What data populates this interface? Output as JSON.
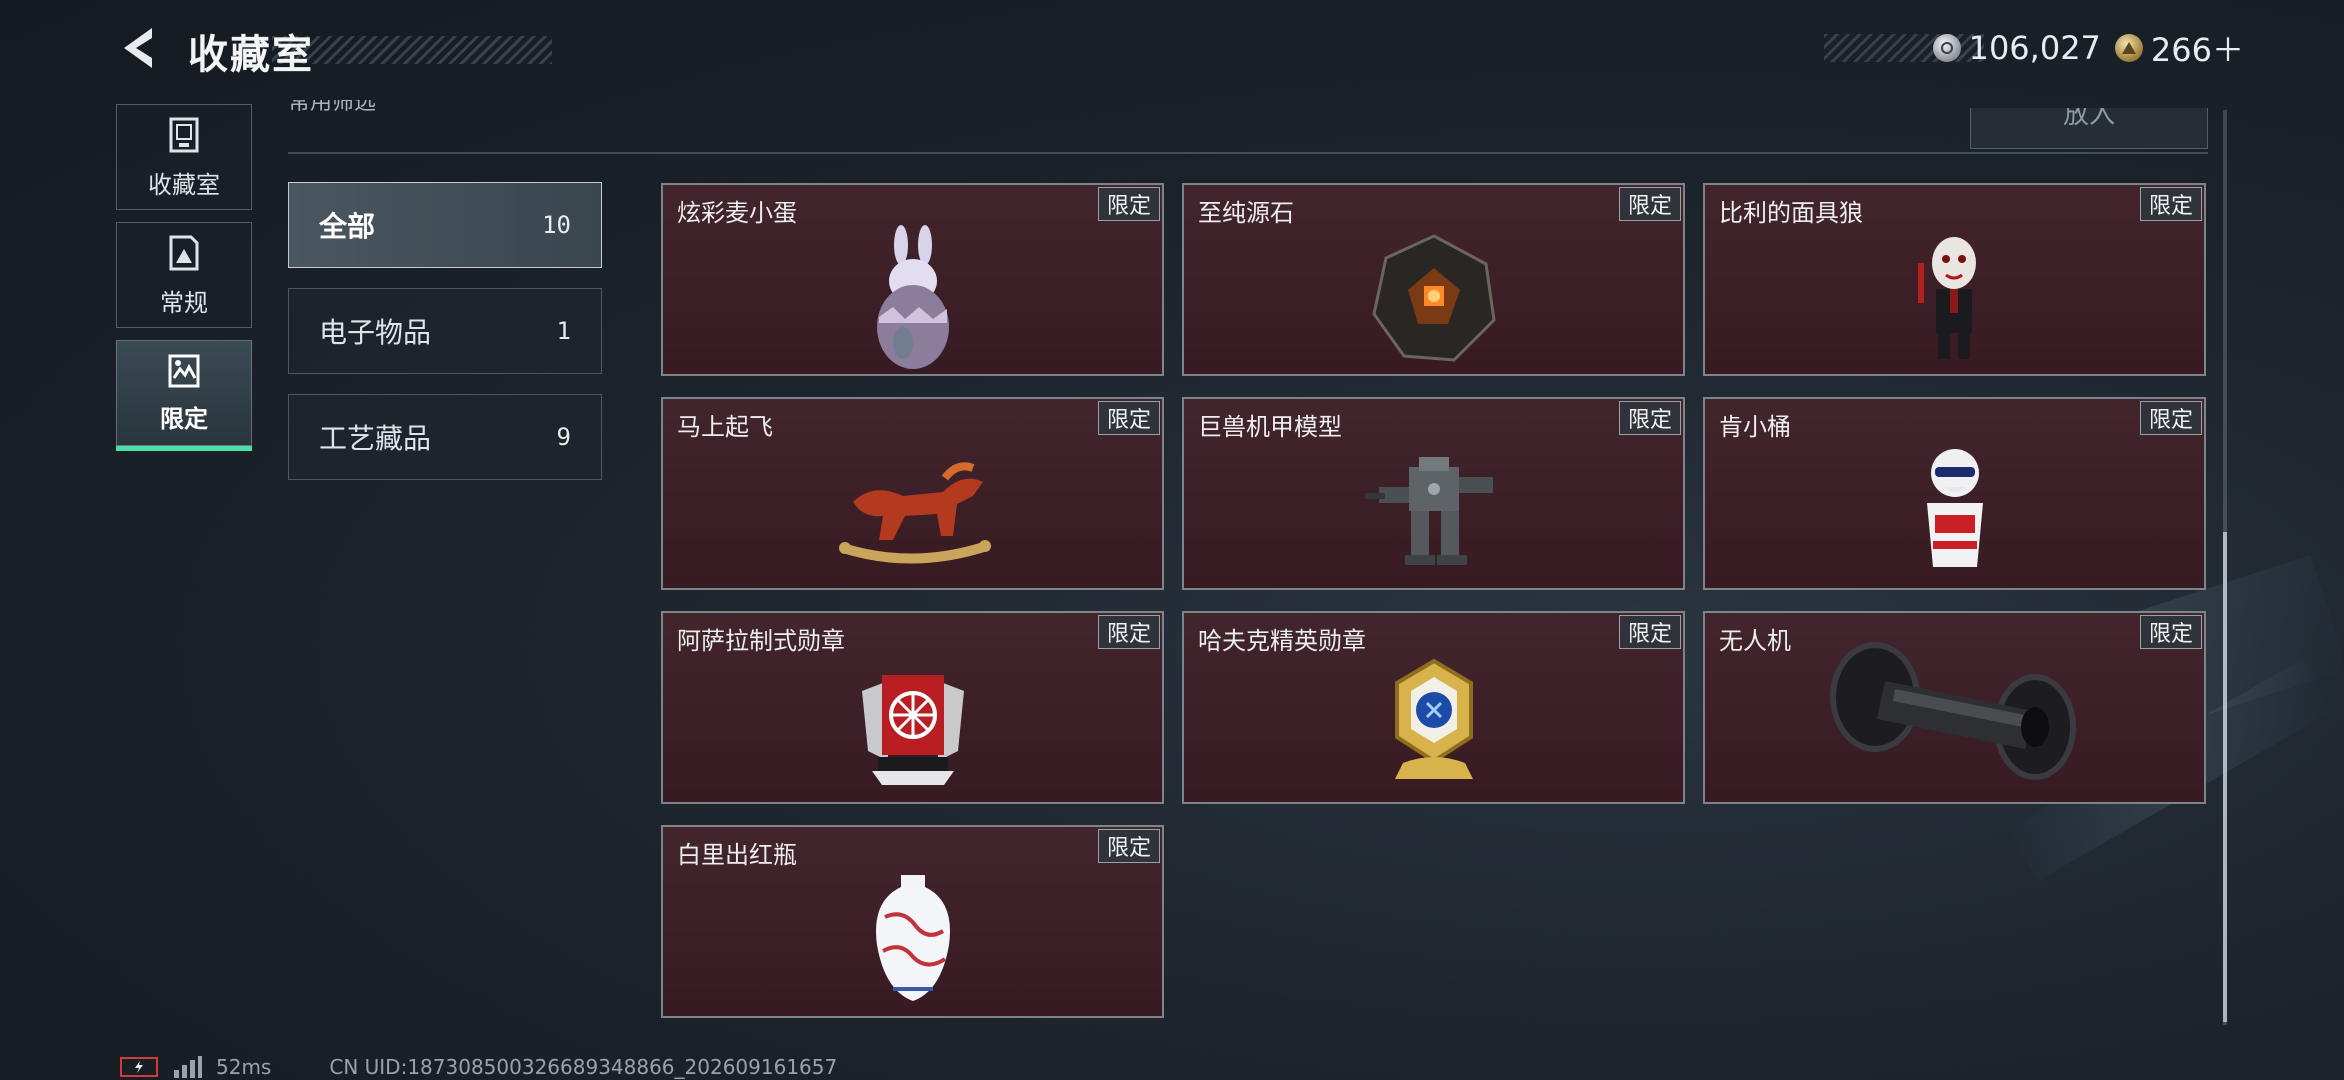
{
  "header": {
    "title": "收藏室",
    "currency": [
      {
        "icon": "silver-coin-icon",
        "value": "106,027"
      },
      {
        "icon": "gold-coin-icon",
        "value": "266＋"
      }
    ]
  },
  "left_nav": [
    {
      "label": "收藏室",
      "icon": "collection-icon",
      "active": false
    },
    {
      "label": "常规",
      "icon": "regular-icon",
      "active": false
    },
    {
      "label": "限定",
      "icon": "limited-icon",
      "active": true
    }
  ],
  "top_strip": {
    "cut_text": "常用筛选",
    "put_button": "放入"
  },
  "categories": [
    {
      "name": "全部",
      "count": "10",
      "active": true
    },
    {
      "name": "电子物品",
      "count": "1",
      "active": false
    },
    {
      "name": "工艺藏品",
      "count": "9",
      "active": false
    }
  ],
  "items": [
    {
      "name": "炫彩麦小蛋",
      "badge": "限定",
      "icon": "rabbit-egg-icon"
    },
    {
      "name": "至纯源石",
      "badge": "限定",
      "icon": "source-stone-icon"
    },
    {
      "name": "比利的面具狼",
      "badge": "限定",
      "icon": "masked-puppet-icon"
    },
    {
      "name": "马上起飞",
      "badge": "限定",
      "icon": "rocking-horse-icon"
    },
    {
      "name": "巨兽机甲模型",
      "badge": "限定",
      "icon": "mech-model-icon"
    },
    {
      "name": "肯小桶",
      "badge": "限定",
      "icon": "bucket-figure-icon"
    },
    {
      "name": "阿萨拉制式勋章",
      "badge": "限定",
      "icon": "asala-medal-icon"
    },
    {
      "name": "哈夫克精英勋章",
      "badge": "限定",
      "icon": "haavk-medal-icon"
    },
    {
      "name": "无人机",
      "badge": "限定",
      "icon": "drone-icon"
    },
    {
      "name": "白里出红瓶",
      "badge": "限定",
      "icon": "porcelain-vase-icon"
    }
  ],
  "status": {
    "ping": "52ms",
    "uid": "CN UID:187308500326689348866_202609161657"
  },
  "colors": {
    "accent": "#48e0a6",
    "card_bg": "#3b1c24",
    "background": "#1c242c"
  }
}
